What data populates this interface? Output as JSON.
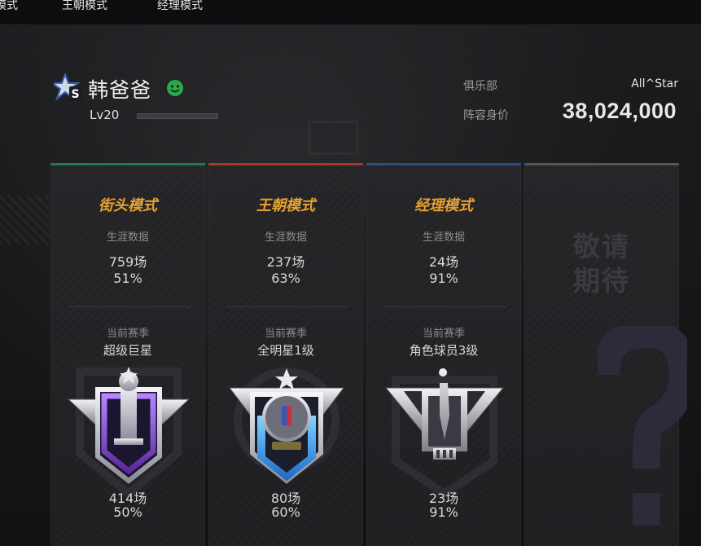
{
  "top_tabs": [
    "模式",
    "王朝模式",
    "经理模式"
  ],
  "player": {
    "name": "韩爸爸",
    "level": "Lv20",
    "xp_fraction": 0.0,
    "badge_letter": "S",
    "status_icon": "smiley-online-icon"
  },
  "club": {
    "label": "俱乐部",
    "value": "All^Star"
  },
  "lineup_value": {
    "label": "阵容身价",
    "value": "38,024,000"
  },
  "cards": [
    {
      "title": "街头模式",
      "accent": "#1f7a5b",
      "career_label": "生涯数据",
      "career_games": "759场",
      "career_rate": "51%",
      "season_label": "当前赛季",
      "season_rank": "超级巨星",
      "season_games": "414场",
      "season_rate": "50%",
      "badge_icon": "superstar-trophy-badge-icon"
    },
    {
      "title": "王朝模式",
      "accent": "#a8372c",
      "career_label": "生涯数据",
      "career_games": "237场",
      "career_rate": "63%",
      "season_label": "当前赛季",
      "season_rank": "全明星1级",
      "season_games": "80场",
      "season_rate": "60%",
      "badge_icon": "allstar-mvp-badge-icon"
    },
    {
      "title": "经理模式",
      "accent": "#2e4d86",
      "career_label": "生涯数据",
      "career_games": "24场",
      "career_rate": "91%",
      "season_label": "当前赛季",
      "season_rank": "角色球员3级",
      "season_games": "23场",
      "season_rate": "91%",
      "badge_icon": "role-player-badge-icon"
    },
    {
      "title": "敬请\n期待",
      "accent": "#555558",
      "placeholder_icon": "question-mark-icon"
    }
  ]
}
